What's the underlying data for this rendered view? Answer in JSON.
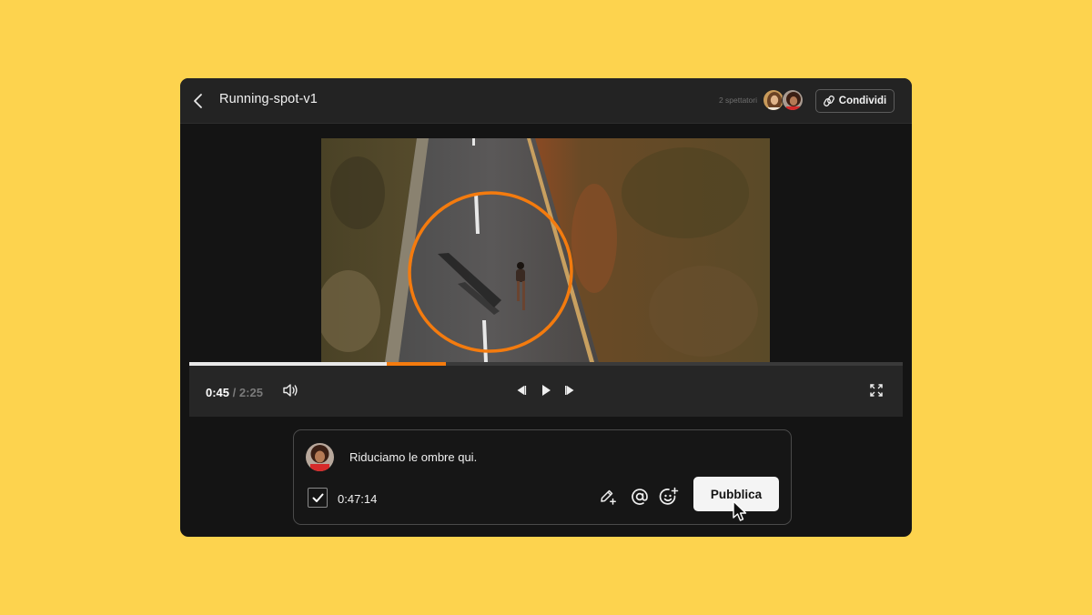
{
  "header": {
    "title": "Running-spot-v1",
    "viewers_label": "2 spettatori",
    "share_label": "Condividi"
  },
  "player": {
    "current_time": "0:45",
    "separator": "/",
    "total_time": "2:25",
    "played_fraction": 0.277,
    "range_start_fraction": 0.277,
    "range_end_fraction": 0.36
  },
  "comment": {
    "text": "Riduciamo le ombre qui.",
    "timestamp": "0:47:14",
    "checked": true,
    "publish_label": "Pubblica"
  },
  "colors": {
    "background": "#FDD34E",
    "accent": "#F47B0E",
    "window": "#141414"
  },
  "icons": [
    "chevron-left-icon",
    "link-icon",
    "volume-icon",
    "skip-back-icon",
    "play-icon",
    "skip-forward-icon",
    "fullscreen-icon",
    "check-icon",
    "pencil-plus-icon",
    "at-icon",
    "emoji-plus-icon",
    "mouse-cursor-icon"
  ]
}
